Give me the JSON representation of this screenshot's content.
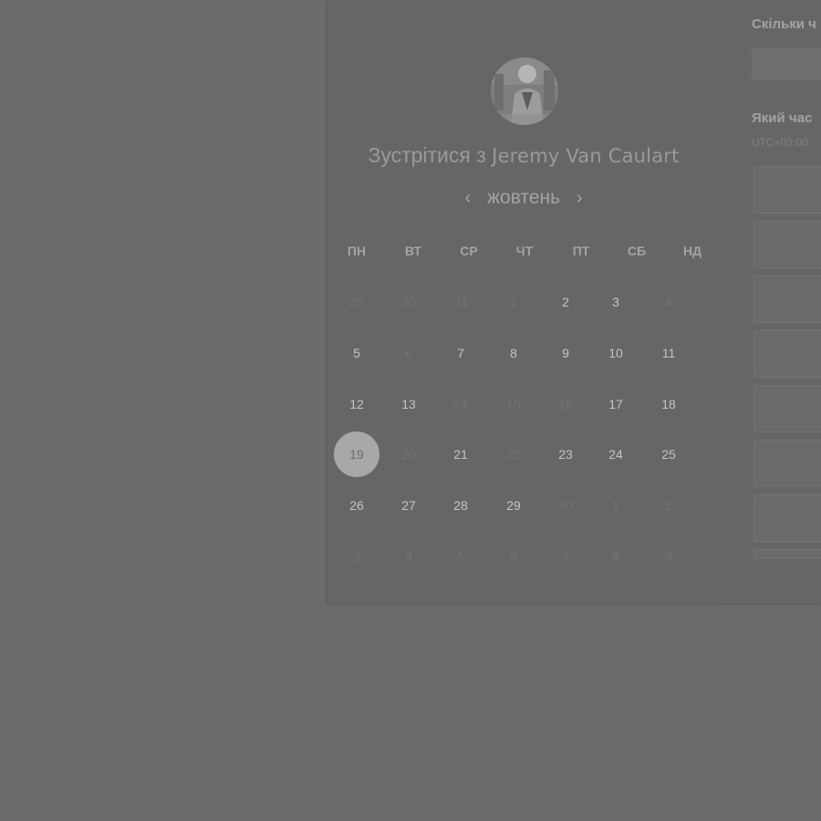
{
  "header": {
    "title_prefix": "Зустрітися з",
    "host_name": "Jeremy Van Caulart"
  },
  "calendar": {
    "month": "жовтень",
    "prev_icon": "chevron-left-icon",
    "next_icon": "chevron-right-icon",
    "weekdays": [
      "ПН",
      "ВТ",
      "СР",
      "ЧТ",
      "ПТ",
      "СБ",
      "НД"
    ],
    "weeks": [
      [
        {
          "d": "29",
          "muted": true
        },
        {
          "d": "30",
          "muted": true
        },
        {
          "d": "31",
          "muted": true
        },
        {
          "d": "1",
          "muted": true
        },
        {
          "d": "2"
        },
        {
          "d": "3"
        },
        {
          "d": "4",
          "muted": true
        }
      ],
      [
        {
          "d": "5"
        },
        {
          "d": "6",
          "muted": true
        },
        {
          "d": "7"
        },
        {
          "d": "8"
        },
        {
          "d": "9"
        },
        {
          "d": "10"
        },
        {
          "d": "11"
        }
      ],
      [
        {
          "d": "12"
        },
        {
          "d": "13"
        },
        {
          "d": "14",
          "muted": true
        },
        {
          "d": "15",
          "muted": true
        },
        {
          "d": "16",
          "muted": true
        },
        {
          "d": "17"
        },
        {
          "d": "18"
        }
      ],
      [
        {
          "d": "19",
          "selected": true
        },
        {
          "d": "20",
          "muted": true
        },
        {
          "d": "21"
        },
        {
          "d": "22",
          "muted": true
        },
        {
          "d": "23"
        },
        {
          "d": "24"
        },
        {
          "d": "25"
        }
      ],
      [
        {
          "d": "26"
        },
        {
          "d": "27"
        },
        {
          "d": "28"
        },
        {
          "d": "29"
        },
        {
          "d": "30",
          "muted": true
        },
        {
          "d": "1",
          "muted": true
        },
        {
          "d": "2",
          "muted": true
        }
      ],
      [
        {
          "d": "3",
          "muted": true
        },
        {
          "d": "4",
          "muted": true
        },
        {
          "d": "5",
          "muted": true
        },
        {
          "d": "6",
          "muted": true
        },
        {
          "d": "7",
          "muted": true
        },
        {
          "d": "8",
          "muted": true
        },
        {
          "d": "9",
          "muted": true
        }
      ]
    ]
  },
  "side": {
    "duration_label": "Скільки ч",
    "time_label": "Який час",
    "timezone": "UTC+03:00",
    "slot_count": 8
  },
  "colors": {
    "overlay": "#6b6b6b",
    "selected_day": "#a8a8a8"
  }
}
